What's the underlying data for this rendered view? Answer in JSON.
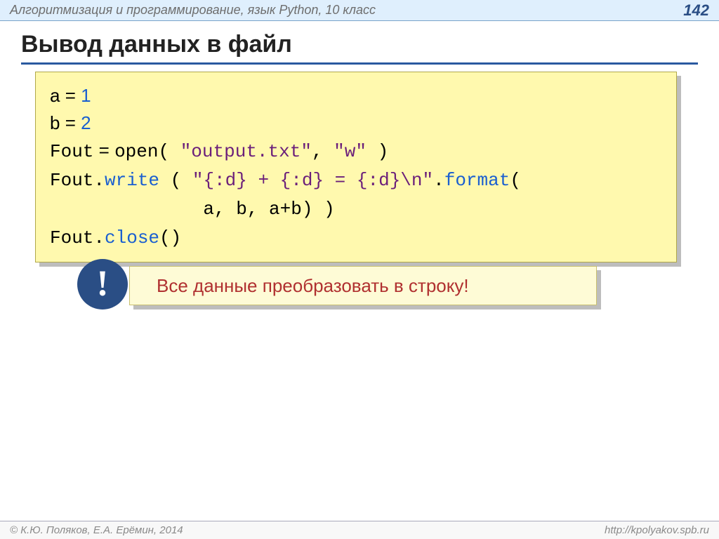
{
  "header": {
    "subject": "Алгоритмизация и программирование, язык Python, 10 класс",
    "page_number": "142"
  },
  "title": "Вывод данных в файл",
  "code": {
    "l1_a": "a",
    "l1_eq": " = ",
    "l1_v": "1",
    "l2_b": "b",
    "l2_eq": " = ",
    "l2_v": "2",
    "l3_a": "Fout",
    "l3_eq": " = ",
    "l3_fn": "open",
    "l3_paren_o": "( ",
    "l3_s1": "\"output.txt\"",
    "l3_comma": ", ",
    "l3_s2": "\"w\"",
    "l3_paren_c": " )",
    "l4_a": "Fout.",
    "l4_m": "write",
    "l4_b": " ( ",
    "l4_s": "\"{:d} + {:d} = {:d}\\n\"",
    "l4_dot": ".",
    "l4_fmt": "format",
    "l4_po": "(",
    "l5_args": "              a, b, a+b) )",
    "l6_a": "Fout.",
    "l6_m": "close",
    "l6_p": "()"
  },
  "callout": {
    "mark": "!",
    "text": "Все данные преобразовать в строку!"
  },
  "footer": {
    "copyright": "© К.Ю. Поляков, Е.А. Ерёмин, 2014",
    "url": "http://kpolyakov.spb.ru"
  }
}
